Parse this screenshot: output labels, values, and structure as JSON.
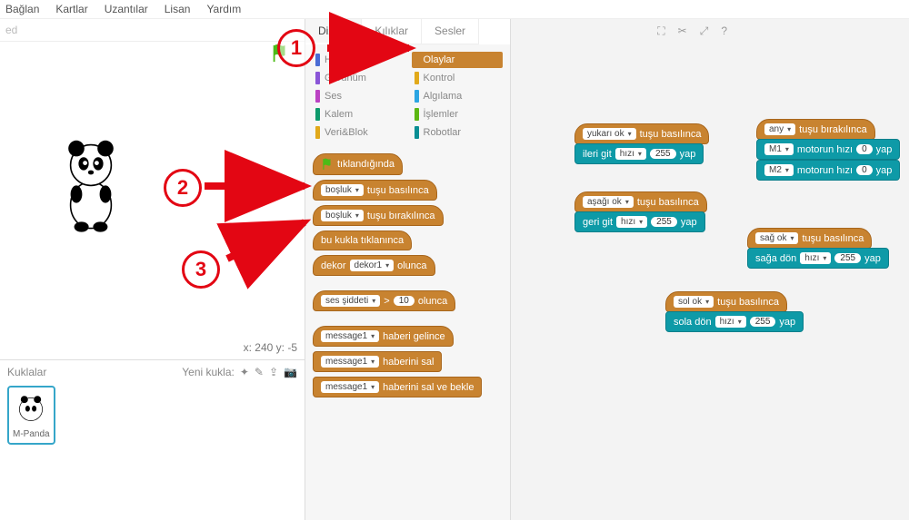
{
  "menu": {
    "items": [
      "Bağlan",
      "Kartlar",
      "Uzantılar",
      "Lisan",
      "Yardım"
    ]
  },
  "stage": {
    "headerText": "ed",
    "coordsLabel": "x: 240 y: -5"
  },
  "spritesPanel": {
    "title": "Kuklalar",
    "newLabel": "Yeni kukla:",
    "spriteName": "M-Panda"
  },
  "tabs": {
    "scripts": "Diziler",
    "costumes": "Kılıklar",
    "sounds": "Sesler"
  },
  "categories": {
    "left": [
      {
        "label": "Hareket",
        "color": "#4a6cd4"
      },
      {
        "label": "Görünüm",
        "color": "#8a55d7"
      },
      {
        "label": "Ses",
        "color": "#bb42c3"
      },
      {
        "label": "Kalem",
        "color": "#0e9a6c"
      },
      {
        "label": "Veri&Blok",
        "color": "#e1a91a"
      }
    ],
    "right": [
      {
        "label": "Olaylar",
        "color": "#c88330",
        "selected": true
      },
      {
        "label": "Kontrol",
        "color": "#e1a91a"
      },
      {
        "label": "Algılama",
        "color": "#2ca5e2"
      },
      {
        "label": "İşlemler",
        "color": "#5cb712"
      },
      {
        "label": "Robotlar",
        "color": "#0a8e93"
      }
    ]
  },
  "palette": {
    "whenFlag": "tıklandığında",
    "keyPressed": {
      "dd": "boşluk",
      "txt": "tuşu basılınca"
    },
    "keyReleased": {
      "dd": "boşluk",
      "txt": "tuşu bırakılınca"
    },
    "spriteClicked": "bu kukla tıklanınca",
    "backdropSwitch": {
      "pre": "dekor",
      "dd": "dekor1",
      "post": "olunca"
    },
    "loudness": {
      "pre": "ses şiddeti",
      "op": ">",
      "val": "10",
      "post": "olunca"
    },
    "msgRecv": {
      "dd": "message1",
      "txt": "haberi gelince"
    },
    "msgBroadcast": {
      "dd": "message1",
      "txt": "haberini sal"
    },
    "msgBroadcastWait": {
      "dd": "message1",
      "txt": "haberini sal ve bekle"
    }
  },
  "scripts": {
    "up": {
      "key": "yukarı ok",
      "hatTxt": "tuşu basılınca",
      "action": "ileri git",
      "speedWord": "hızı",
      "val": "255",
      "yap": "yap"
    },
    "down": {
      "key": "aşağı ok",
      "hatTxt": "tuşu basılınca",
      "action": "geri git",
      "speedWord": "hızı",
      "val": "255",
      "yap": "yap"
    },
    "right": {
      "key": "sağ ok",
      "hatTxt": "tuşu basılınca",
      "action": "sağa dön",
      "speedWord": "hızı",
      "val": "255",
      "yap": "yap"
    },
    "left": {
      "key": "sol ok",
      "hatTxt": "tuşu basılınca",
      "action": "sola dön",
      "speedWord": "hızı",
      "val": "255",
      "yap": "yap"
    },
    "release": {
      "key": "any",
      "hatTxt": "tuşu bırakılınca",
      "m1": {
        "dd": "M1",
        "txt": "motorun hızı",
        "val": "0",
        "yap": "yap"
      },
      "m2": {
        "dd": "M2",
        "txt": "motorun hızı",
        "val": "0",
        "yap": "yap"
      }
    }
  },
  "annotations": {
    "n1": "1",
    "n2": "2",
    "n3": "3"
  }
}
